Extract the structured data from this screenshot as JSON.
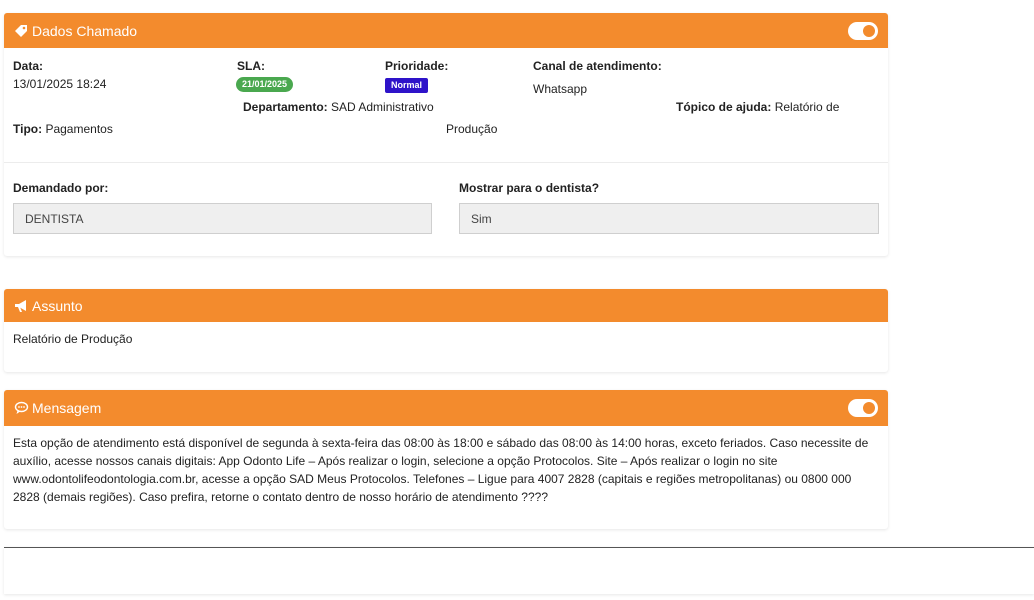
{
  "dados": {
    "title": "Dados Chamado",
    "data_label": "Data:",
    "data_value": "13/01/2025 18:24",
    "sla_label": "SLA:",
    "sla_value": "21/01/2025",
    "prioridade_label": "Prioridade:",
    "prioridade_value": "Normal",
    "canal_label": "Canal de atendimento:",
    "canal_value": "Whatsapp",
    "departamento_label": "Departamento:",
    "departamento_value": "SAD Administrativo",
    "topico_label": "Tópico de ajuda:",
    "topico_value_1": "Relatório de",
    "topico_value_2": "Produção",
    "tipo_label": "Tipo:",
    "tipo_value": "Pagamentos",
    "demandado_label": "Demandado por:",
    "demandado_value": "DENTISTA",
    "mostrar_label": "Mostrar para o dentista?",
    "mostrar_value": "Sim"
  },
  "assunto": {
    "title": "Assunto",
    "text": "Relatório de Produção"
  },
  "mensagem": {
    "title": "Mensagem",
    "text": "Esta opção de atendimento está disponível de segunda à sexta-feira das 08:00 às 18:00 e sábado das 08:00 às 14:00 horas, exceto feriados. Caso necessite de auxílio, acesse nossos canais digitais: App Odonto Life – Após realizar o login, selecione a opção Protocolos. Site – Após realizar o login no site www.odontolifeodontologia.com.br, acesse a opção SAD Meus Protocolos. Telefones – Ligue para 4007 2828 (capitais e regiões metropolitanas) ou 0800 000 2828 (demais regiões). Caso prefira, retorne o contato dentro de nosso horário de atendimento ????"
  },
  "colors": {
    "header": "#f38b2d",
    "sla_badge": "#4aa84f",
    "priority_badge": "#2e13c9"
  }
}
